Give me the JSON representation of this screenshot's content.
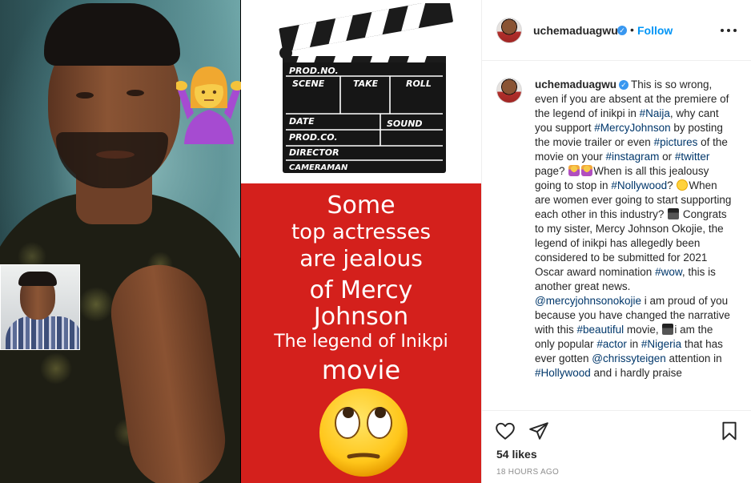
{
  "post": {
    "username": "uchemaduagwu",
    "separator": "•",
    "follow_label": "Follow",
    "more_icon": "more-options-icon",
    "verified_mark": "✓"
  },
  "poster": {
    "clapper_labels": [
      "PROD.NO.",
      "SCENE",
      "TAKE",
      "ROLL",
      "DATE",
      "SOUND",
      "PROD.CO.",
      "DIRECTOR",
      "CAMERAMAN"
    ],
    "line1": "Some",
    "line2": "top actresses",
    "line3": "are jealous",
    "line4": "of Mercy",
    "line5": "Johnson",
    "line6": "The legend of Inikpi",
    "line7": "movie",
    "bg_color": "#d4201c"
  },
  "caption": {
    "username": "uchemaduagwu",
    "t1": "This is so wrong, even if you are absent at the premiere of the legend of inikpi in ",
    "h_naija": "#Naija",
    "t2": ", why cant you support ",
    "h_mercy": "#MercyJohnson",
    "t3": " by posting the movie trailer or even ",
    "h_pictures": "#pictures",
    "t4": " of the movie on your ",
    "h_instagram": "#instagram",
    "t5": " or ",
    "h_twitter": "#twitter",
    "t6": " page? ",
    "t7": "When is all this jealousy going to stop in ",
    "h_nollywood": "#Nollywood",
    "t8": "? ",
    "t9": "When are women ever going to start supporting each other in this industry? ",
    "t10": " Congrats to my sister, Mercy Johnson Okojie, the legend of inikpi has allegedly been considered to be submitted for 2021 Oscar award nomination ",
    "h_wow": "#wow",
    "t11": ", this is another great news. ",
    "m_mercy": "@mercyjohnsonokojie",
    "t12": " i am proud of you because you have changed the narrative with this ",
    "h_beautiful": "#beautiful",
    "t13": " movie, ",
    "t14": "i am the only popular ",
    "h_actor": "#actor",
    "t15": " in ",
    "h_nigeria": "#Nigeria",
    "t16": " that has ever gotten ",
    "m_chrissy": "@chrissyteigen",
    "t17": " attention in ",
    "h_hollywood": "#Hollywood",
    "t18": " and i hardly praise"
  },
  "actions": {
    "like_icon": "heart-icon",
    "share_icon": "paper-plane-icon",
    "save_icon": "bookmark-icon",
    "likes": "54 likes",
    "time": "18 HOURS AGO"
  },
  "colors": {
    "link": "#00376b",
    "follow": "#0095f6",
    "verified": "#3897f0",
    "muted": "#8e8e8e"
  }
}
